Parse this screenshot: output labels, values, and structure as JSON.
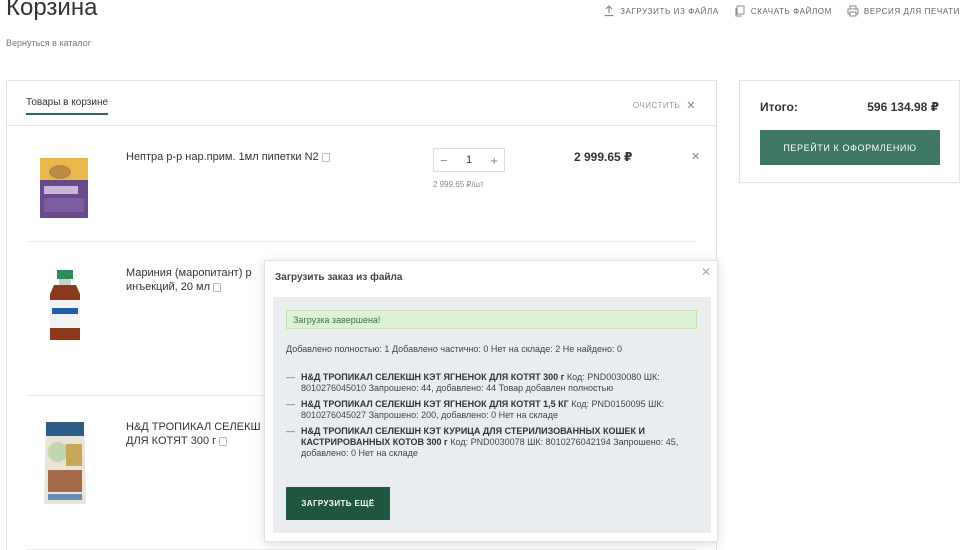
{
  "page": {
    "title": "Корзина",
    "back_link": "Вернуться в каталог"
  },
  "top_actions": [
    {
      "label": "ЗАГРУЗИТЬ ИЗ ФАЙЛА",
      "icon": "upload-icon"
    },
    {
      "label": "СКАЧАТЬ ФАЙЛОМ",
      "icon": "file-copy-icon"
    },
    {
      "label": "ВЕРСИЯ ДЛЯ ПЕЧАТИ",
      "icon": "printer-icon"
    }
  ],
  "cart": {
    "tab_label": "Товары в корзине",
    "clear_label": "ОЧИСТИТЬ",
    "items": [
      {
        "name": "Нептра р-р нар.прим. 1мл пипетки N2",
        "qty": "1",
        "unit_price": "2 999.65 ₽/шт",
        "price": "2 999.65 ₽",
        "image": "neptra-box"
      },
      {
        "name": "Мариния (маропитант) р",
        "name_line2": "инъекций, 20 мл",
        "image": "marinia-vial"
      },
      {
        "name": "Н&Д ТРОПИКАЛ СЕЛЕКШ",
        "name_line2": "ДЛЯ КОТЯТ 300 г",
        "image": "nd-food-bag"
      }
    ]
  },
  "summary": {
    "label": "Итого:",
    "total": "596 134.98 ₽",
    "checkout_label": "ПЕРЕЙТИ К ОФОРМЛЕНИЮ"
  },
  "modal": {
    "title": "Загрузить заказ из файла",
    "success_message": "Загрузка завершена!",
    "stats": "Добавлено полностью: 1 Добавлено частично: 0 Нет на складе: 2 Не найдено: 0",
    "results": [
      {
        "product": "Н&Д ТРОПИКАЛ СЕЛЕКШН КЭТ ЯГНЕНОК ДЛЯ КОТЯТ 300 г",
        "details": "Код: PND0030080 ШК: 8010276045010 Запрошено: 44, добавлено: 44 Товар добавлен полностью"
      },
      {
        "product": "Н&Д ТРОПИКАЛ СЕЛЕКШН КЭТ ЯГНЕНОК ДЛЯ КОТЯТ 1,5 КГ",
        "details": "Код: PND0150095 ШК: 8010276045027 Запрошено: 200, добавлено: 0 Нет на складе"
      },
      {
        "product": "Н&Д ТРОПИКАЛ СЕЛЕКШН КЭТ КУРИЦА ДЛЯ СТЕРИЛИЗОВАННЫХ КОШЕК И КАСТРИРОВАННЫХ КОТОВ 300 г",
        "details": "Код: PND0030078 ШК: 8010276042194 Запрошено: 45, добавлено: 0 Нет на складе"
      }
    ],
    "upload_more_label": "ЗАГРУЗИТЬ ЕЩЁ"
  },
  "colors": {
    "accent": "#3f7762",
    "accent_dark": "#1e5640",
    "success_bg": "#dff0d8"
  }
}
